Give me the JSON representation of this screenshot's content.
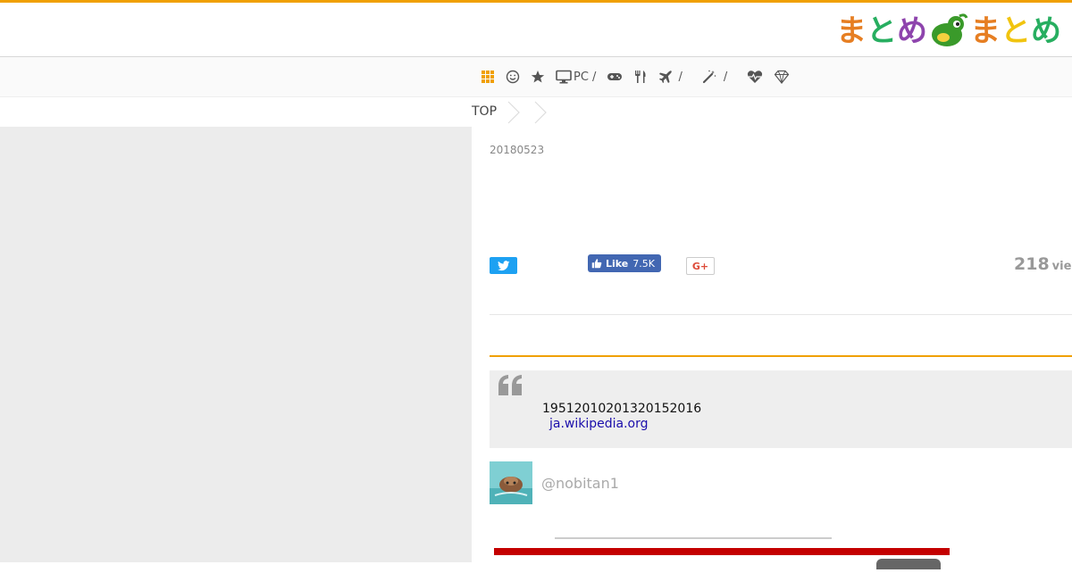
{
  "logo": {
    "chars": [
      "ま",
      "と",
      "め",
      "ま",
      "と",
      "め"
    ],
    "mascot": "green-leaf-mascot"
  },
  "nav": {
    "items": [
      {
        "icon": "grid-icon",
        "label": "",
        "accent": "#f0a000"
      },
      {
        "icon": "smile-icon",
        "label": ""
      },
      {
        "icon": "star-icon",
        "label": ""
      },
      {
        "icon": "monitor-icon",
        "label": "PC /"
      },
      {
        "icon": "gamepad-icon",
        "label": ""
      },
      {
        "icon": "fork-knife-icon",
        "label": ""
      },
      {
        "icon": "airplane-icon",
        "label": "/"
      },
      {
        "icon": "magic-wand-icon",
        "label": "/"
      },
      {
        "icon": "heartbeat-icon",
        "label": ""
      },
      {
        "icon": "gem-icon",
        "label": ""
      }
    ]
  },
  "breadcrumb": {
    "top_label": "TOP"
  },
  "article": {
    "date": "20180523",
    "share": {
      "facebook_like_label": "Like",
      "facebook_like_count": "7.5K",
      "google_plus_label": "G+"
    },
    "views": {
      "count": "218",
      "unit": "view"
    },
    "quote": {
      "text": "19512010201320152016",
      "link": "ja.wikipedia.org"
    },
    "user": {
      "handle": "@nobitan1"
    }
  },
  "colors": {
    "accent": "#f0a000",
    "twitter": "#1da1f2",
    "facebook": "#4267b2",
    "google_plus": "#dd4b39",
    "link": "#1a0dab"
  }
}
